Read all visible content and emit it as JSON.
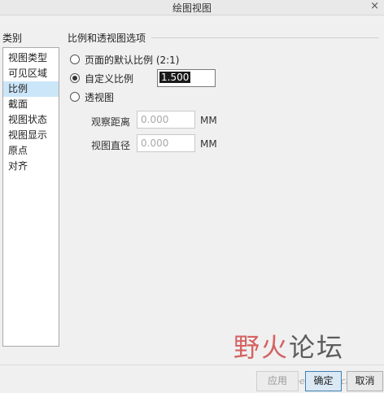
{
  "window": {
    "title": "绘图视图",
    "close_glyph": "×"
  },
  "categories": {
    "label": "类别",
    "items": [
      {
        "label": "视图类型"
      },
      {
        "label": "可见区域"
      },
      {
        "label": "比例"
      },
      {
        "label": "截面"
      },
      {
        "label": "视图状态"
      },
      {
        "label": "视图显示"
      },
      {
        "label": "原点"
      },
      {
        "label": "对齐"
      }
    ],
    "selected": "比例"
  },
  "scale_options": {
    "group_title": "比例和透视图选项",
    "default_scale_label": "页面的默认比例 (2:1)",
    "custom_scale_label": "自定义比例",
    "custom_scale_value": "1.500",
    "perspective_label": "透视图",
    "selected": "custom",
    "viewing_distance_label": "观察距离",
    "viewing_distance_value": "0.000",
    "view_diameter_label": "视图直径",
    "view_diameter_value": "0.000",
    "unit": "MM"
  },
  "buttons": {
    "apply": "应用",
    "ok": "确定",
    "cancel": "取消"
  },
  "watermark": {
    "text_red": "野火",
    "text_dark": "论坛",
    "url": "www.proewildfire.cn"
  }
}
